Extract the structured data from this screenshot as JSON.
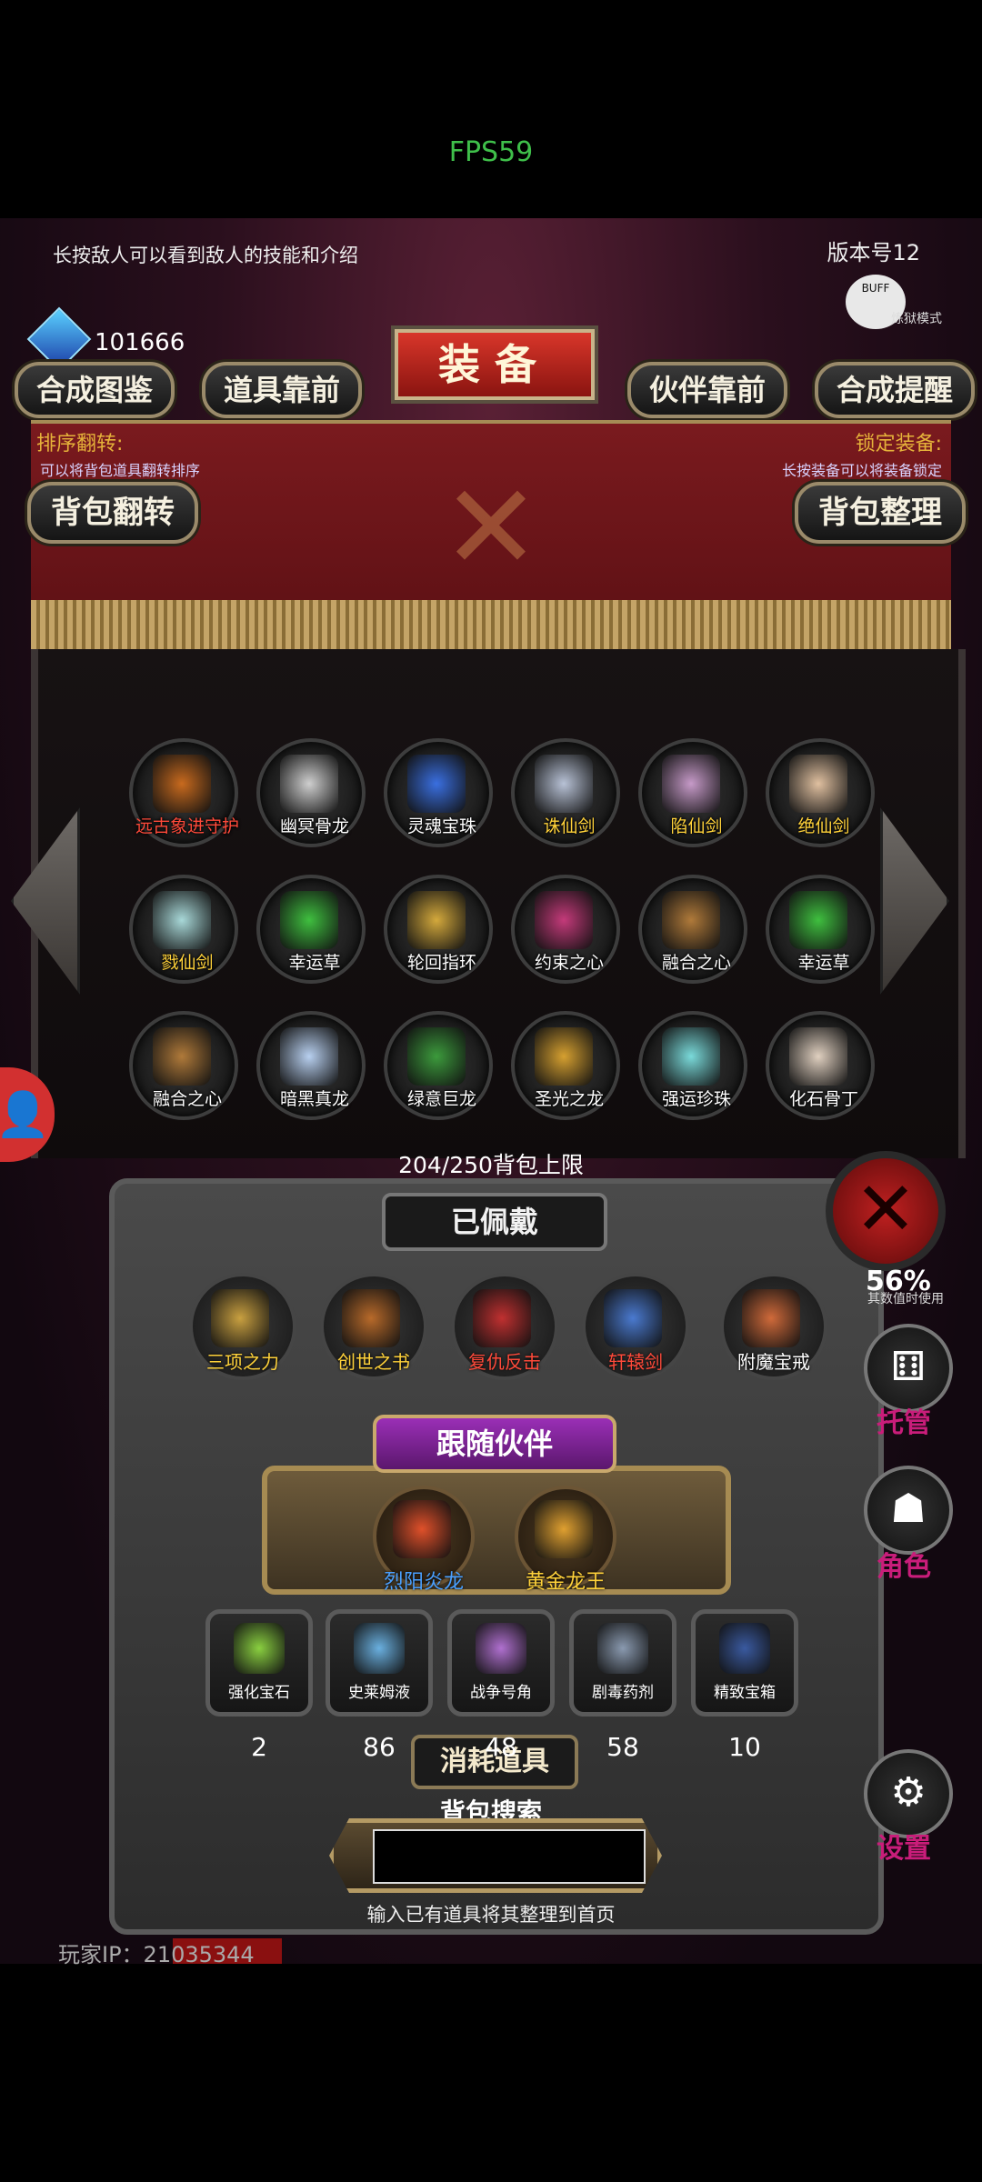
{
  "status": {
    "fps": "FPS59"
  },
  "header": {
    "hint": "长按敌人可以看到敌人的技能和介绍",
    "version": "版本号12",
    "buff_logo_text": "BUFF",
    "buff_mode": "炼狱模式",
    "currency": "101666"
  },
  "toolbar": {
    "synthesis_guide": "合成图鉴",
    "items_front": "道具靠前",
    "title": "装备",
    "partners_front": "伙伴靠前",
    "synthesis_reminder": "合成提醒"
  },
  "options": {
    "sort_flip_title": "排序翻转:",
    "sort_flip_desc": "可以将背包道具翻转排序",
    "lock_title": "锁定装备:",
    "lock_desc": "长按装备可以将装备锁定",
    "bag_flip": "背包翻转",
    "bag_sort": "背包整理"
  },
  "inventory": {
    "items": [
      {
        "label": "远古象进守护",
        "color": "#c86a1e",
        "label_color": "#ff4a3a"
      },
      {
        "label": "幽冥骨龙",
        "color": "#cfcfcf",
        "label_color": "#ffffff"
      },
      {
        "label": "灵魂宝珠",
        "color": "#3a6fe0",
        "label_color": "#ffffff"
      },
      {
        "label": "诛仙剑",
        "color": "#b8c2d6",
        "label_color": "#ffd23a"
      },
      {
        "label": "陷仙剑",
        "color": "#c69ac8",
        "label_color": "#ffd23a"
      },
      {
        "label": "绝仙剑",
        "color": "#e0c0a0",
        "label_color": "#ffd23a"
      },
      {
        "label": "戮仙剑",
        "color": "#a8d8d8",
        "label_color": "#ffd23a"
      },
      {
        "label": "幸运草",
        "color": "#3fbf3f",
        "label_color": "#ffffff"
      },
      {
        "label": "轮回指环",
        "color": "#d4a93c",
        "label_color": "#ffffff"
      },
      {
        "label": "约束之心",
        "color": "#c43a7a",
        "label_color": "#ffffff"
      },
      {
        "label": "融合之心",
        "color": "#b07a3a",
        "label_color": "#ffffff"
      },
      {
        "label": "幸运草",
        "color": "#3fbf3f",
        "label_color": "#ffffff"
      },
      {
        "label": "融合之心",
        "color": "#b07a3a",
        "label_color": "#ffffff"
      },
      {
        "label": "暗黑真龙",
        "color": "#b8d0f0",
        "label_color": "#ffffff"
      },
      {
        "label": "绿意巨龙",
        "color": "#3c9a3c",
        "label_color": "#ffffff"
      },
      {
        "label": "圣光之龙",
        "color": "#d6a030",
        "label_color": "#ffffff"
      },
      {
        "label": "强运珍珠",
        "color": "#7adada",
        "label_color": "#ffffff"
      },
      {
        "label": "化石骨丁",
        "color": "#e0d0c0",
        "label_color": "#ffffff"
      }
    ],
    "capacity": "204/250背包上限"
  },
  "equipped": {
    "title": "已佩戴",
    "items": [
      {
        "label": "三项之力",
        "color": "#c9a040",
        "label_color": "#ffd23a"
      },
      {
        "label": "创世之书",
        "color": "#b86a2a",
        "label_color": "#ffd23a"
      },
      {
        "label": "复仇反击",
        "color": "#c03030",
        "label_color": "#ff4a3a"
      },
      {
        "label": "轩辕剑",
        "color": "#4a7ad0",
        "label_color": "#ff4a3a"
      },
      {
        "label": "附魔宝戒",
        "color": "#d06a3a",
        "label_color": "#ffffff"
      }
    ]
  },
  "companions": {
    "title": "跟随伙伴",
    "items": [
      {
        "label": "烈阳炎龙",
        "color": "#e0502a",
        "label_color": "#4aa0ff"
      },
      {
        "label": "黄金龙王",
        "color": "#e0a030",
        "label_color": "#ffd23a"
      }
    ]
  },
  "consumables": {
    "title": "消耗道具",
    "items": [
      {
        "label": "强化宝石",
        "count": "2",
        "color": "#8ad040"
      },
      {
        "label": "史莱姆液",
        "count": "86",
        "color": "#6ab0e0"
      },
      {
        "label": "战争号角",
        "count": "48",
        "color": "#b070d0"
      },
      {
        "label": "剧毒药剂",
        "count": "58",
        "color": "#8a9ab0"
      },
      {
        "label": "精致宝箱",
        "count": "10",
        "color": "#3a5aa0"
      }
    ]
  },
  "search": {
    "title": "背包搜索",
    "value": "",
    "hint": "输入已有道具将其整理到首页"
  },
  "player": {
    "ip": "玩家IP：21035344"
  },
  "side": {
    "percent": "56%",
    "percent_sub": "其数值时使用",
    "manager": "托管",
    "role": "角色",
    "settings": "设置"
  }
}
